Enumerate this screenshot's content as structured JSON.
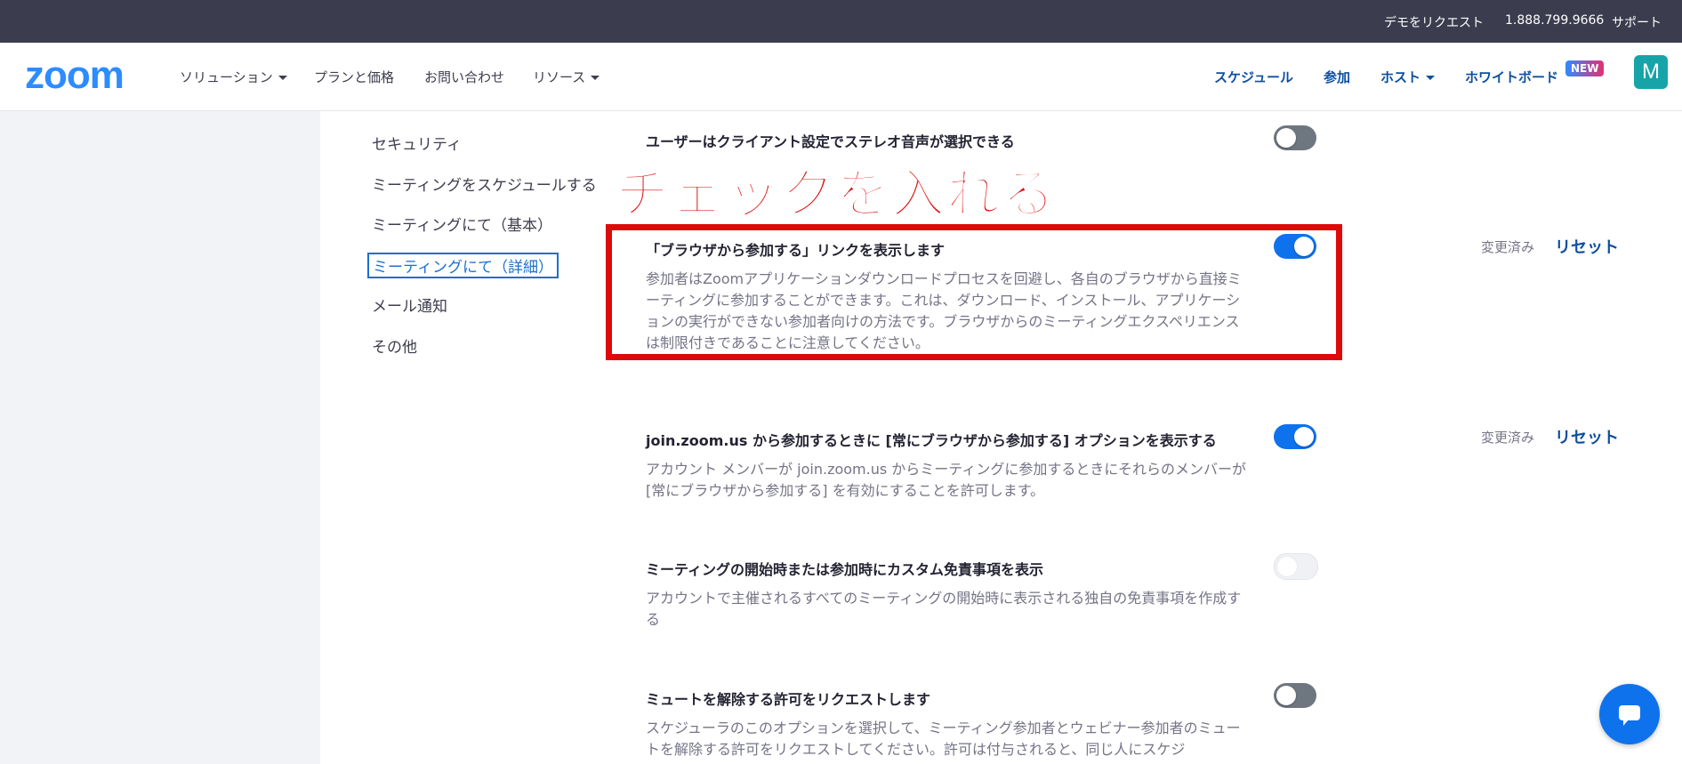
{
  "topbar": {
    "request_demo": "デモをリクエスト",
    "phone": "1.888.799.9666",
    "support": "サポート"
  },
  "nav": {
    "logo": "zoom",
    "solutions": "ソリューション",
    "plans": "プランと価格",
    "contact": "お問い合わせ",
    "resources": "リソース",
    "schedule": "スケジュール",
    "join": "参加",
    "host": "ホスト",
    "whiteboard": "ホワイトボード",
    "new_badge": "NEW",
    "avatar_letter": "M"
  },
  "sidebar": {
    "items": [
      {
        "label": "セキュリティ"
      },
      {
        "label": "ミーティングをスケジュールする"
      },
      {
        "label": "ミーティングにて（基本）"
      },
      {
        "label": "ミーティングにて（詳細）"
      },
      {
        "label": "メール通知"
      },
      {
        "label": "その他"
      }
    ]
  },
  "annotation": {
    "text": "チェックを入れる",
    "color": "#dd0a0a"
  },
  "settings": [
    {
      "title": "ユーザーはクライアント設定でステレオ音声が選択できる",
      "description": "",
      "toggle": "off"
    },
    {
      "title": "「ブラウザから参加する」リンクを表示します",
      "description": "参加者はZoomアプリケーションダウンロードプロセスを回避し、各自のブラウザから直接ミーティングに参加することができます。これは、ダウンロード、インストール、アプリケーションの実行ができない参加者向けの方法です。ブラウザからのミーティングエクスペリエンスは制限付きであることに注意してください。",
      "toggle": "on",
      "modified": "変更済み",
      "reset": "リセット"
    },
    {
      "title": "join.zoom.us から参加するときに [常にブラウザから参加する] オプションを表示する",
      "description": "アカウント メンバーが join.zoom.us からミーティングに参加するときにそれらのメンバーが [常にブラウザから参加する] を有効にすることを許可します。",
      "toggle": "on",
      "modified": "変更済み",
      "reset": "リセット"
    },
    {
      "title": "ミーティングの開始時または参加時にカスタム免責事項を表示",
      "description": "アカウントで主催されるすべてのミーティングの開始時に表示される独自の免責事項を作成する",
      "toggle": "disabled"
    },
    {
      "title": "ミュートを解除する許可をリクエストします",
      "description": "スケジューラのこのオプションを選択して、ミーティング参加者とウェビナー参加者のミュートを解除する許可をリクエストしてください。許可は付与されると、同じ人にスケジ",
      "toggle": "off"
    }
  ],
  "colors": {
    "accent": "#0e72ed",
    "link": "#0e4f9f",
    "topbar": "#3b3c4e"
  }
}
